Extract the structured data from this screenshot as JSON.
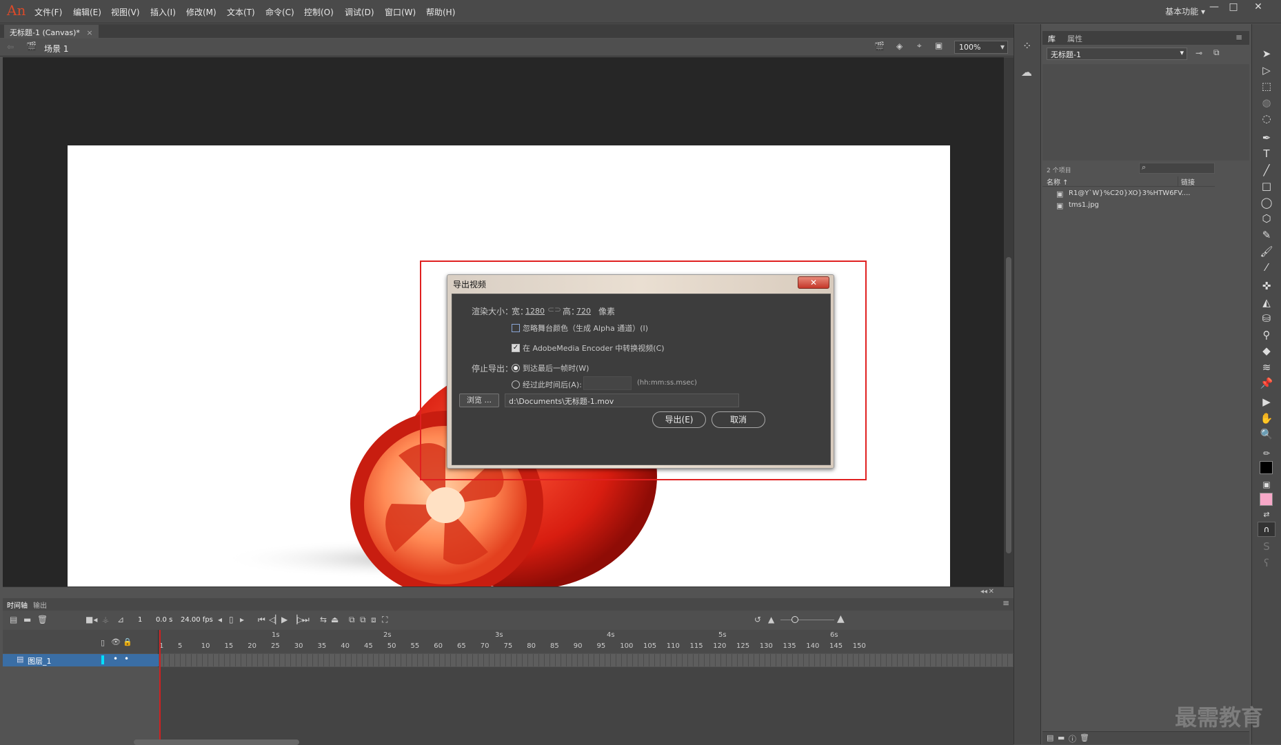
{
  "app": {
    "logo": "An"
  },
  "menu": [
    "文件(F)",
    "编辑(E)",
    "视图(V)",
    "插入(I)",
    "修改(M)",
    "文本(T)",
    "命令(C)",
    "控制(O)",
    "调试(D)",
    "窗口(W)",
    "帮助(H)"
  ],
  "workspace": "基本功能",
  "window_buttons": [
    "—",
    "□",
    "✕"
  ],
  "doc_tab": {
    "title": "无标题-1 (Canvas)*",
    "close": "×"
  },
  "editbar": {
    "scene": "场景 1",
    "zoom": "100%"
  },
  "dialog": {
    "title": "导出视频",
    "close": "✕",
    "render_size_label": "渲染大小：",
    "width_label": "宽：",
    "width_value": "1280",
    "height_label": "高：",
    "height_value": "720",
    "unit": "像素",
    "ignore_stage_color": "忽略舞台颜色（生成 Alpha 通道）(I)",
    "ignore_stage_color_checked": false,
    "convert_in_ame": "在 AdobeMedia Encoder 中转换视频(C)",
    "convert_in_ame_checked": true,
    "stop_export_label": "停止导出：",
    "option_last_frame": "到达最后一帧时(W)",
    "option_after_time": "经过此时间后(A):",
    "selected_option": "last_frame",
    "time_format": "(hh:mm:ss.msec)",
    "browse": "浏览 ...",
    "path": "d:\\Documents\\无标题-1.mov",
    "export_button": "导出(E)",
    "cancel_button": "取消"
  },
  "library": {
    "tabs": [
      "库",
      "属性"
    ],
    "document": "无标题-1",
    "item_count": "2 个项目",
    "col_name": "名称 ↑",
    "col_link": "链接",
    "items": [
      "R1@Y`W}%C20}XO}3%HTW6FV....",
      "tms1.jpg"
    ]
  },
  "timeline": {
    "tabs": [
      "时间轴",
      "输出"
    ],
    "frame": "1",
    "time": "0.0 s",
    "fps": "24.00 fps",
    "layer": "图层_1",
    "seconds": [
      "1s",
      "2s",
      "3s",
      "4s",
      "5s",
      "6s"
    ],
    "ticks": [
      "1",
      "5",
      "10",
      "15",
      "20",
      "25",
      "30",
      "35",
      "40",
      "45",
      "50",
      "55",
      "60",
      "65",
      "70",
      "75",
      "80",
      "85",
      "90",
      "95",
      "100",
      "105",
      "110",
      "115",
      "120",
      "125",
      "130",
      "135",
      "140",
      "145",
      "150"
    ]
  },
  "watermark": "最需教育",
  "colors": {
    "accent_red": "#e02020",
    "layer_highlight": "#3a6ea5",
    "fill_swatch": "#f7a8c8",
    "stroke_swatch": "#000000"
  }
}
